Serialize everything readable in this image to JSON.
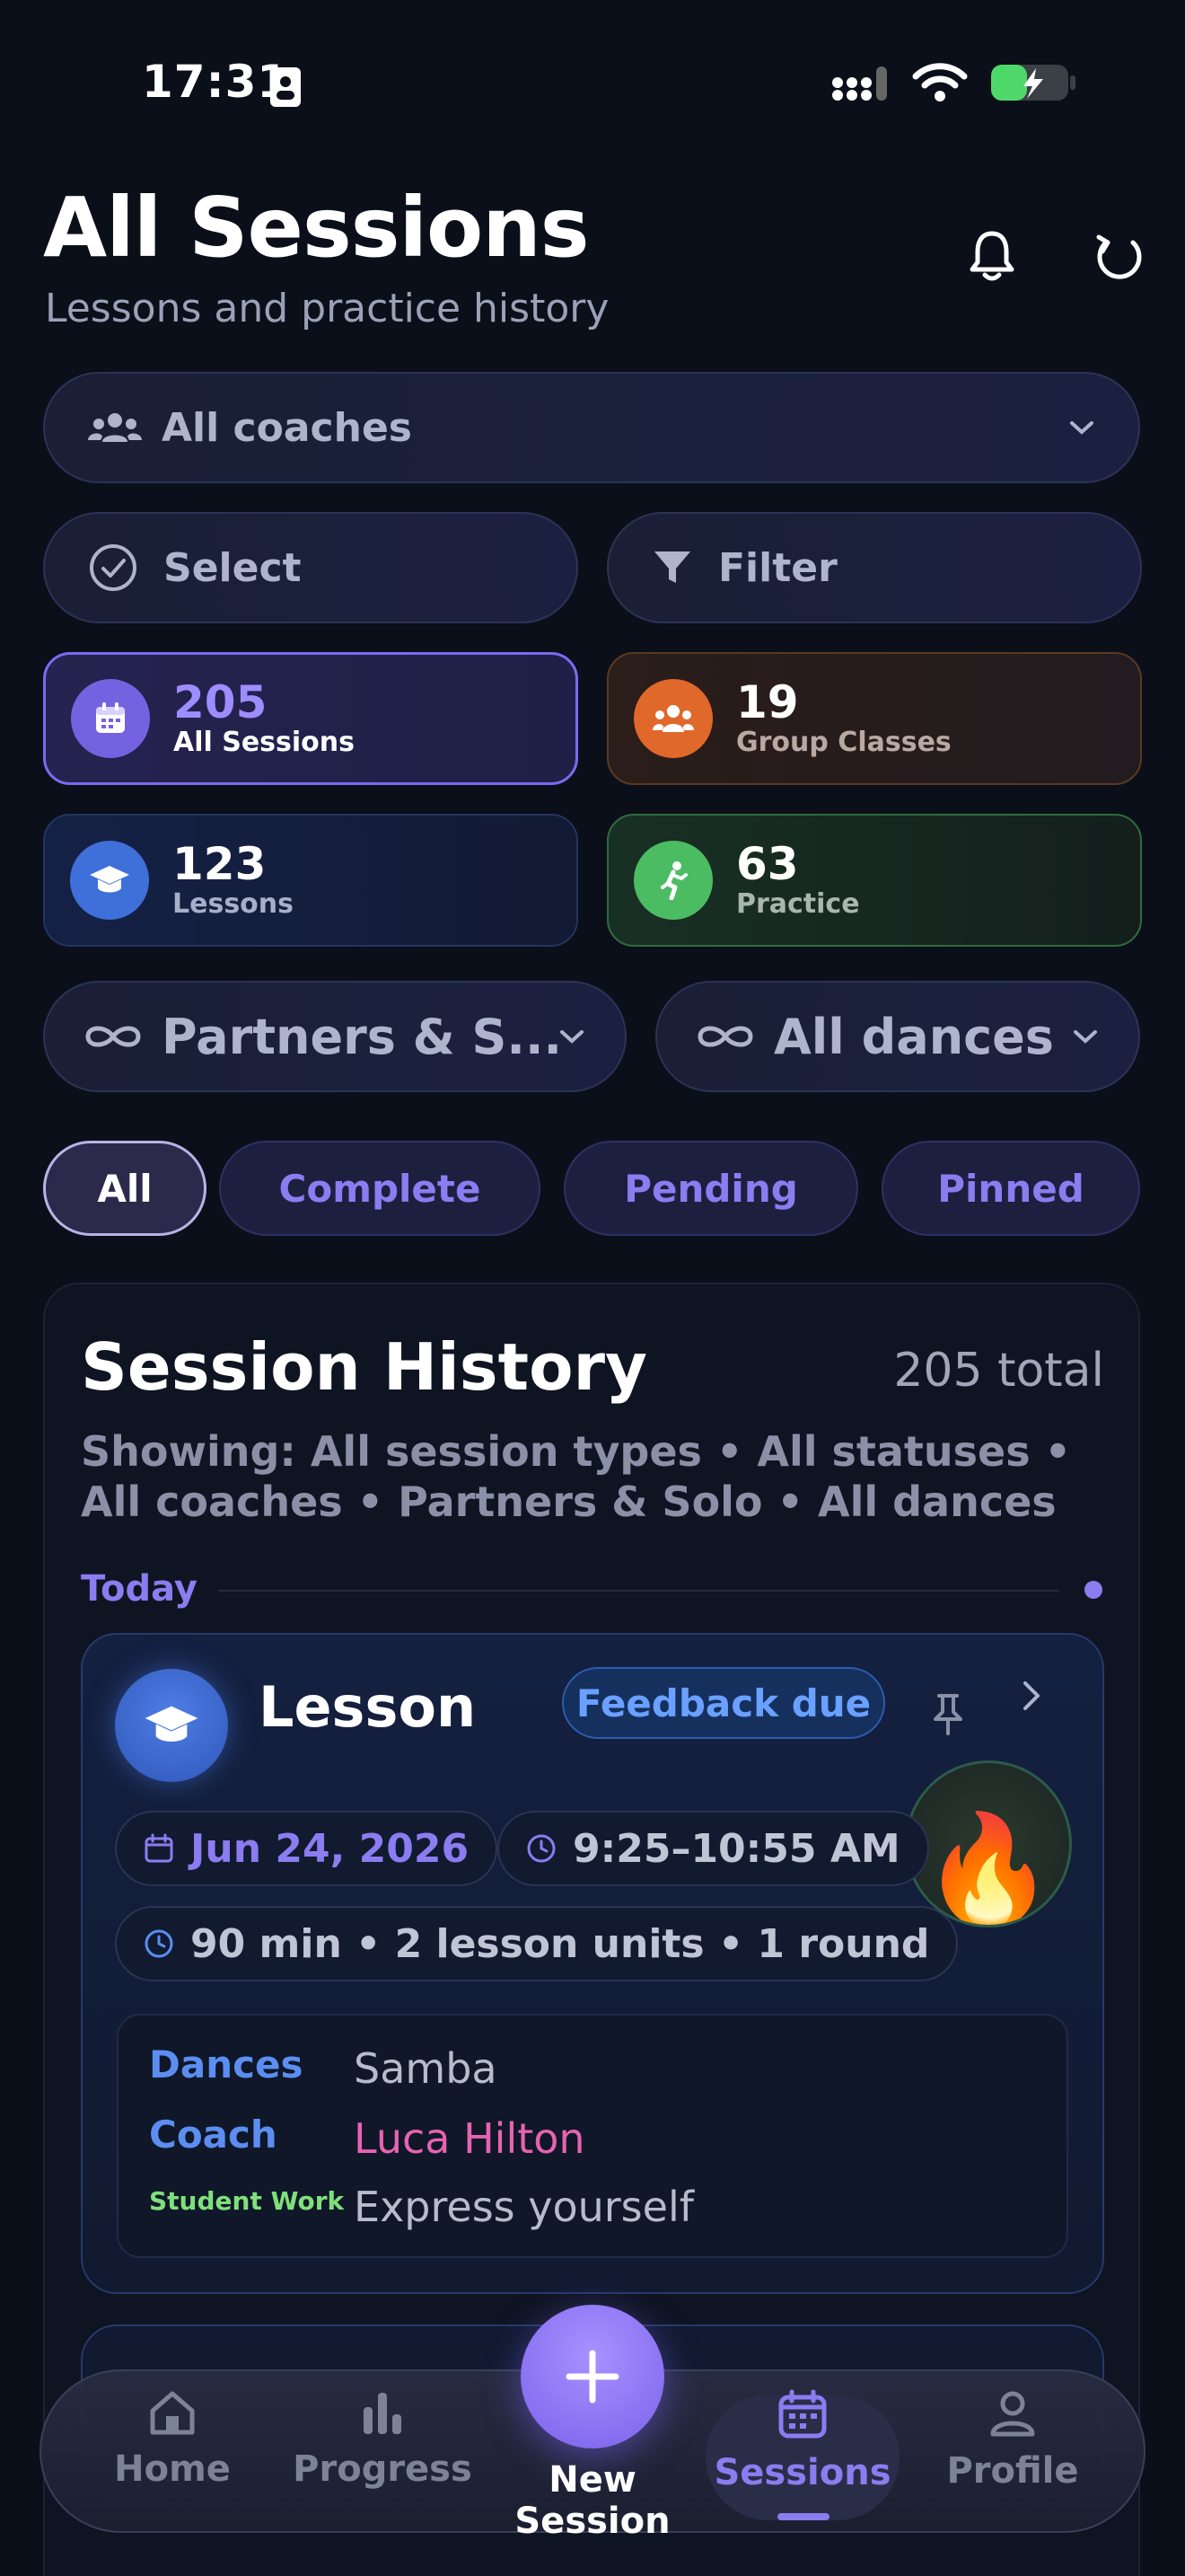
{
  "status_bar": {
    "time": "17:31"
  },
  "header": {
    "title": "All Sessions",
    "subtitle": "Lessons and practice history"
  },
  "coach_filter": {
    "selected": "All coaches"
  },
  "actions": {
    "select_label": "Select",
    "filter_label": "Filter"
  },
  "stats": [
    {
      "value": "205",
      "label": "All Sessions"
    },
    {
      "value": "19",
      "label": "Group Classes"
    },
    {
      "value": "123",
      "label": "Lessons"
    },
    {
      "value": "63",
      "label": "Practice"
    }
  ],
  "dance_filters": {
    "partner_selected": "Partners & S...",
    "dance_selected": "All dances"
  },
  "status_chips": [
    "All",
    "Complete",
    "Pending",
    "Pinned"
  ],
  "history": {
    "title": "Session History",
    "total": "205 total",
    "showing": "Showing: All session types • All statuses • All coaches • Partners & Solo • All dances",
    "group_label": "Today",
    "session": {
      "type": "Lesson",
      "badge": "Feedback due",
      "date": "Jun 24, 2026",
      "time": "9:25–10:55 AM",
      "duration": "90 min • 2 lesson units • 1 round",
      "emoji": "🔥",
      "details": [
        {
          "label": "Dances",
          "value": "Samba",
          "label_color": "#5b8ef0",
          "value_color": "#b7bccb"
        },
        {
          "label": "Coach",
          "value": "Luca Hilton",
          "label_color": "#5b8ef0",
          "value_color": "#e763b0"
        },
        {
          "label": "Student Work",
          "value": "Express yourself",
          "label_color": "#7fe07a",
          "value_color": "#b7bccb"
        }
      ]
    }
  },
  "nav": {
    "items": [
      "Home",
      "Progress",
      "New Session",
      "Sessions",
      "Profile"
    ],
    "active": "Sessions"
  },
  "colors": {
    "accent": "#8b7cf0",
    "background": "#0b0f19"
  }
}
